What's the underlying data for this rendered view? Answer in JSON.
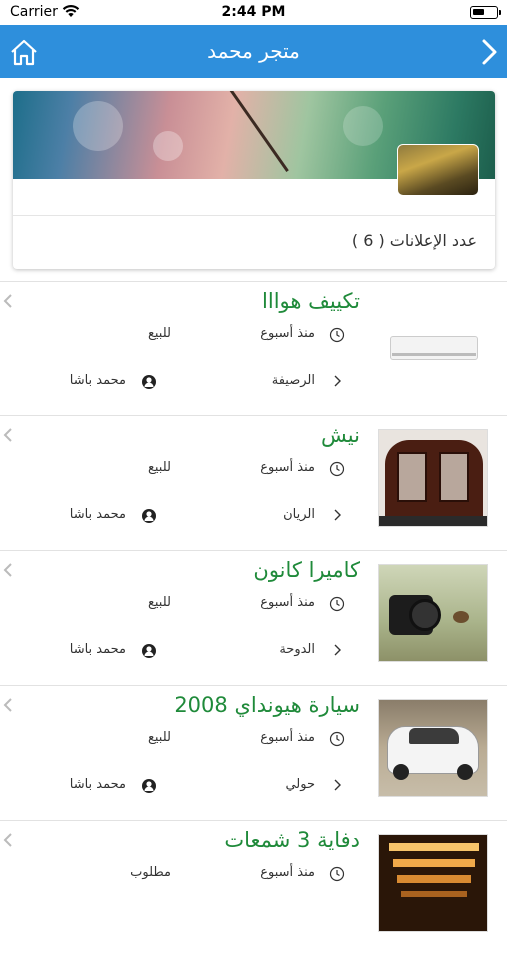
{
  "status_bar": {
    "carrier": "Carrier",
    "time": "2:44 PM"
  },
  "nav": {
    "title": "متجر محمد"
  },
  "store": {
    "ads_count": "عدد الإعلانات ( 6 )"
  },
  "items": [
    {
      "title": "تكييف هوااا",
      "time": "منذ أسبوع",
      "type": "للبيع",
      "location": "الرصيفة",
      "user": "محمد باشا",
      "thumb": "air-conditioner"
    },
    {
      "title": "نيش",
      "time": "منذ أسبوع",
      "type": "للبيع",
      "location": "الريان",
      "user": "محمد باشا",
      "thumb": "cabinet"
    },
    {
      "title": "كاميرا كانون",
      "time": "منذ أسبوع",
      "type": "للبيع",
      "location": "الدوحة",
      "user": "محمد باشا",
      "thumb": "camera"
    },
    {
      "title": "سيارة هيونداي 2008",
      "time": "منذ أسبوع",
      "type": "للبيع",
      "location": "حولي",
      "user": "محمد باشا",
      "thumb": "car"
    },
    {
      "title": "دفاية 3 شمعات",
      "time": "منذ أسبوع",
      "type": "مطلوب",
      "location": "",
      "user": "",
      "thumb": "heater"
    }
  ],
  "colors": {
    "nav_bg": "#2e8fdc",
    "title_green": "#1f8a3a"
  }
}
